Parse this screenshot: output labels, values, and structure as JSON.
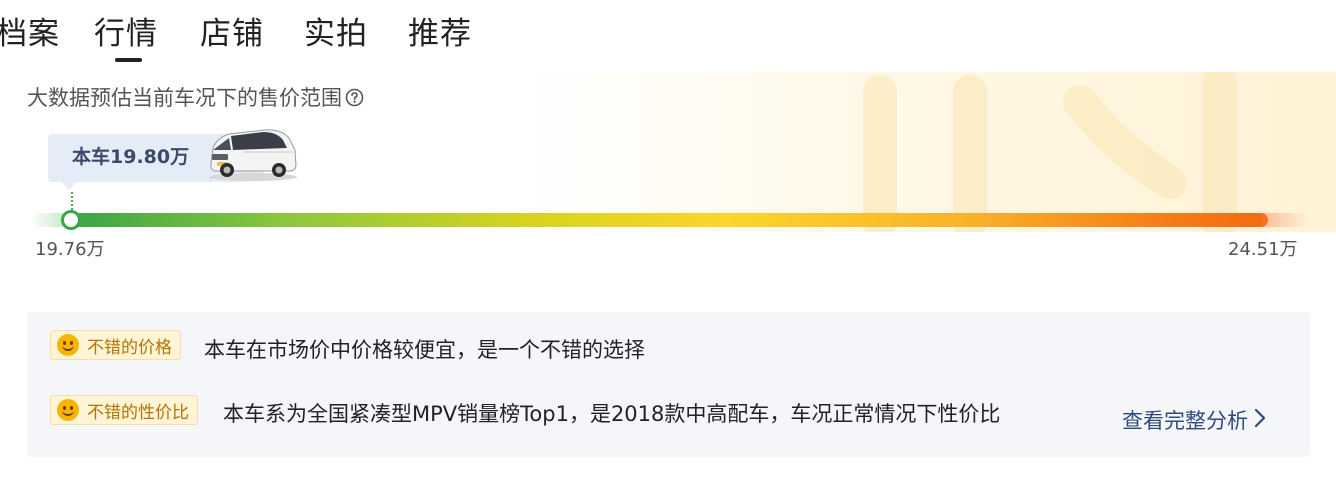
{
  "tabs": [
    {
      "label": "档案"
    },
    {
      "label": "行情",
      "active": true
    },
    {
      "label": "店铺"
    },
    {
      "label": "实拍"
    },
    {
      "label": "推荐"
    }
  ],
  "estimate": {
    "title": "大数据预估当前车况下的售价范围",
    "help_icon": "question-circle-icon"
  },
  "current_price": {
    "label": "本车19.80万",
    "car_image": "white-mpv-car-image"
  },
  "price_range": {
    "min_label": "19.76万",
    "max_label": "24.51万",
    "current_position_fraction": 0.008,
    "bar_colors": [
      "#3aa546",
      "#8cc63e",
      "#fbd52b",
      "#f8b22a",
      "#f26a10"
    ]
  },
  "analysis": {
    "rows": [
      {
        "tag": "不错的价格",
        "tag_icon": "smile-emoji-icon",
        "text": "本车在市场价中价格较便宜，是一个不错的选择"
      },
      {
        "tag": "不错的性价比",
        "tag_icon": "smile-emoji-icon",
        "text": "本车系为全国紧凑型MPV销量榜Top1，是2018款中高配车，车况正常情况下性价比"
      }
    ],
    "more_link": "查看完整分析",
    "more_icon": "chevron-right-icon"
  },
  "colors": {
    "tag_bg": "#fff4d6",
    "tag_text": "#b37400",
    "link": "#2f4a7c",
    "bubble_bg": "#e4ecf8",
    "card_bg": "#f4f6fa"
  }
}
